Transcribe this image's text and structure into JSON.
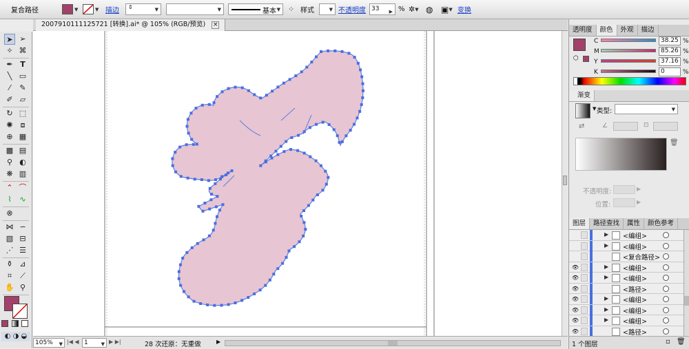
{
  "control_bar": {
    "object_type": "复合路径",
    "stroke_label": "描边",
    "stroke_value": "",
    "brush_name": "基本",
    "style_label": "样式",
    "opacity_label": "不透明度",
    "opacity_value": "33",
    "percent_sign": "%",
    "transform_label": "变换",
    "fill_color": "#a3416a"
  },
  "document": {
    "tab_title": "20079101111​25721 [转换].ai* @ 105% (RGB/预览)",
    "close_glyph": "×"
  },
  "status_bar": {
    "zoom": "105%",
    "artboard": "1",
    "undo_text": "28 次还原：无重做"
  },
  "color_panel": {
    "tabs": [
      "透明度",
      "颜色",
      "外观",
      "描边"
    ],
    "active_tab": "颜色",
    "swatch_color": "#a3416a",
    "channels": [
      {
        "label": "C",
        "value": "38.25"
      },
      {
        "label": "M",
        "value": "85.26"
      },
      {
        "label": "Y",
        "value": "37.16"
      },
      {
        "label": "K",
        "value": "0"
      }
    ],
    "percent_sign": "%"
  },
  "gradient_panel": {
    "title": "渐变",
    "type_label": "类型:",
    "type_value": "",
    "opacity_label": "不透明度:",
    "position_label": "位置:"
  },
  "layers_panel": {
    "tabs": [
      "图层",
      "路径查找",
      "属性",
      "颜色参考"
    ],
    "active_tab": "图层",
    "rows": [
      {
        "name": "<编组>",
        "eye": false,
        "expand": true
      },
      {
        "name": "<编组>",
        "eye": false,
        "expand": true
      },
      {
        "name": "<复合路径>",
        "eye": false,
        "expand": false
      },
      {
        "name": "<编组>",
        "eye": true,
        "expand": true
      },
      {
        "name": "<编组>",
        "eye": true,
        "expand": true
      },
      {
        "name": "<路径>",
        "eye": true,
        "expand": false
      },
      {
        "name": "<编组>",
        "eye": true,
        "expand": true
      },
      {
        "name": "<编组>",
        "eye": true,
        "expand": true
      },
      {
        "name": "<编组>",
        "eye": true,
        "expand": true
      },
      {
        "name": "<路径>",
        "eye": true,
        "expand": false
      }
    ],
    "footer": "1 个图层"
  },
  "colors": {
    "shape_fill": "#e8c5d2",
    "anchor": "#4a6ee0",
    "path_stroke": "#5a7fe6"
  }
}
